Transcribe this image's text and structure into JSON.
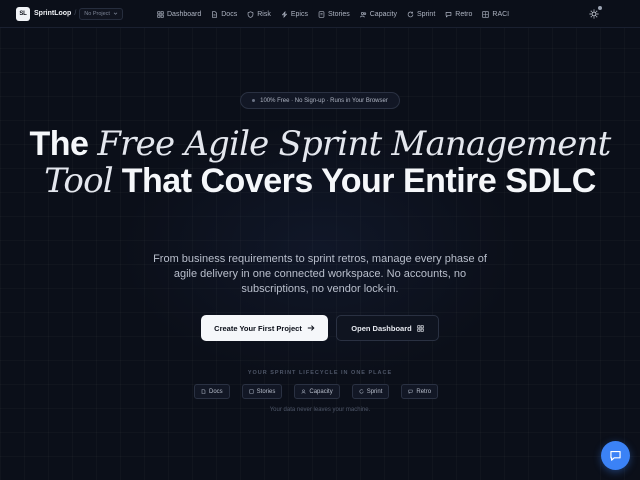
{
  "brand": {
    "logo": "SL",
    "name": "SprintLoop",
    "separator": "/",
    "project": "No Project"
  },
  "nav": {
    "items": [
      {
        "label": "Dashboard",
        "icon": "grid-icon"
      },
      {
        "label": "Docs",
        "icon": "document-icon"
      },
      {
        "label": "Risk",
        "icon": "shield-icon"
      },
      {
        "label": "Epics",
        "icon": "lightning-icon"
      },
      {
        "label": "Stories",
        "icon": "book-icon"
      },
      {
        "label": "Capacity",
        "icon": "people-icon"
      },
      {
        "label": "Sprint",
        "icon": "refresh-icon"
      },
      {
        "label": "Retro",
        "icon": "chat-icon"
      },
      {
        "label": "RACI",
        "icon": "grid-icon"
      }
    ],
    "theme_icon": "sun-icon"
  },
  "hero": {
    "pill": "100% Free · No Sign-up · Runs in Your Browser",
    "headline_bold_1": "The",
    "headline_italic": "Free Agile Sprint Management Tool",
    "headline_bold_2": "That Covers Your Entire SDLC",
    "subtext": "From business requirements to sprint retros, manage every phase of agile delivery in one connected workspace. No accounts, no subscriptions, no vendor lock-in.",
    "cta_primary": "Create Your First Project",
    "cta_secondary": "Open Dashboard"
  },
  "lifecycle": {
    "label": "YOUR SPRINT LIFECYCLE IN ONE PLACE",
    "steps": [
      {
        "label": "Docs",
        "icon": "document-icon"
      },
      {
        "label": "Stories",
        "icon": "book-icon"
      },
      {
        "label": "Capacity",
        "icon": "people-icon"
      },
      {
        "label": "Sprint",
        "icon": "refresh-icon"
      },
      {
        "label": "Retro",
        "icon": "chat-icon"
      }
    ],
    "footnote": "Your data never leaves your machine."
  },
  "colors": {
    "background": "#0b0f19",
    "accent": "#3b82f6",
    "text": "#f5f7fa"
  }
}
